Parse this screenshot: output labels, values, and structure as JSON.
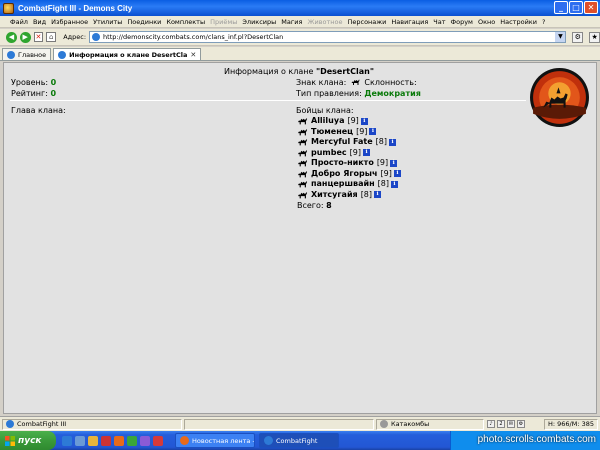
{
  "window": {
    "title": "CombatFight III - Demons City",
    "buttons": [
      "_",
      "□",
      "✕"
    ]
  },
  "menu": [
    {
      "label": "Файл",
      "disabled": false
    },
    {
      "label": "Вид",
      "disabled": false
    },
    {
      "label": "Избранное",
      "disabled": false
    },
    {
      "label": "Утилиты",
      "disabled": false
    },
    {
      "label": "Поединки",
      "disabled": false
    },
    {
      "label": "Комплекты",
      "disabled": false
    },
    {
      "label": "Приёмы",
      "disabled": true
    },
    {
      "label": "Эликсиры",
      "disabled": false
    },
    {
      "label": "Магия",
      "disabled": false
    },
    {
      "label": "Животное",
      "disabled": true
    },
    {
      "label": "Персонажи",
      "disabled": false
    },
    {
      "label": "Навигация",
      "disabled": false
    },
    {
      "label": "Чат",
      "disabled": false
    },
    {
      "label": "Форум",
      "disabled": false
    },
    {
      "label": "Окно",
      "disabled": false
    },
    {
      "label": "Настройки",
      "disabled": false
    },
    {
      "label": "?",
      "disabled": false
    }
  ],
  "address": {
    "label": "Адрес:",
    "url": "http://demonscity.combats.com/clans_inf.pl?DesertClan"
  },
  "tabs": [
    {
      "label": "Главное",
      "active": false
    },
    {
      "label": "Информация о клане DesertCla",
      "active": true
    }
  ],
  "clan": {
    "header_prefix": "Информация о клане",
    "name": "\"DesertClan\"",
    "level_label": "Уровень:",
    "level_value": "0",
    "rating_label": "Рейтинг:",
    "rating_value": "0",
    "sign_label": "Знак клана:",
    "alignment_label": "Склонность:",
    "government_label": "Тип правления:",
    "government_value": "Демократия",
    "head_label": "Глава клана:",
    "members_title": "Бойцы клана:",
    "members": [
      {
        "name": "Alliluya",
        "level": "[9]"
      },
      {
        "name": "Тюменец",
        "level": "[9]"
      },
      {
        "name": "Mercyful Fate",
        "level": "[8]"
      },
      {
        "name": "pumbec",
        "level": "[9]"
      },
      {
        "name": "Просто-никто",
        "level": "[9]"
      },
      {
        "name": "Добро Ягорыч",
        "level": "[9]"
      },
      {
        "name": "панцершвайн",
        "level": "[8]"
      },
      {
        "name": "Хитсугайя",
        "level": "[8]"
      }
    ],
    "info_glyph": "i",
    "total_label": "Всего:",
    "total_value": "8"
  },
  "statusbar": {
    "app": "CombatFight III",
    "location": "Катакомбы",
    "counter": "2",
    "hp": "H: 966/M: 385"
  },
  "taskbar": {
    "start": "пуск",
    "items": [
      {
        "label": "Новостная лента - D...",
        "active": false
      },
      {
        "label": "CombatFight",
        "active": true
      }
    ],
    "watermark": "photo.scrolls.combats.com"
  },
  "colors": {
    "green_value": "#0a7a0a",
    "titlebar": "#0a5ee3",
    "content_bg": "#e2e2e2"
  }
}
